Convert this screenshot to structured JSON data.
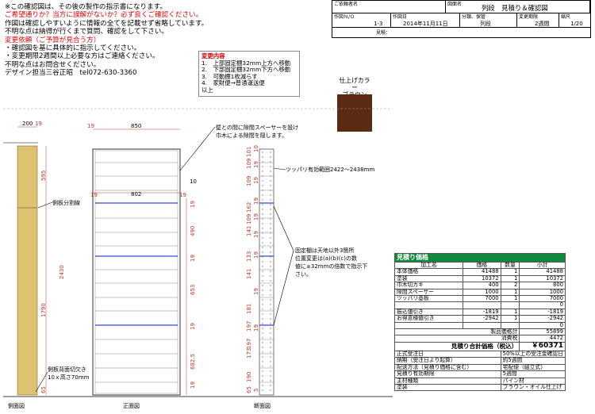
{
  "notes": {
    "lines": [
      {
        "text": "※この確認図は、その後の製作の指示書になります。",
        "mark": "※",
        "red": false
      },
      {
        "text": "ご希望通りか？当方に誤解がないか？必ず良くご確認ください。",
        "red": true
      },
      {
        "text": "作図は確認しやすいように情報の全てを記載せず省略しています。",
        "red": false
      },
      {
        "text": "不明な点は納得が行くまで質問、確認をして下さい。",
        "red": false
      },
      {
        "text": "変更依頼（ご予算が見合う方）",
        "red": true
      },
      {
        "text": "・確認図を基に具体的に指示してください。",
        "red": false
      },
      {
        "text": "・変更期限2週間以上必要な方はご連絡ください。",
        "red": false
      },
      {
        "text": "不明な点はお問合せください。",
        "red": false
      },
      {
        "text": "デザイン担当三谷正昭　tel072-630-3360",
        "red": false
      }
    ]
  },
  "header": {
    "customer_label": "ご依頼者名",
    "drawing_name_label": "図面名",
    "drawing_name": "列段　見積り＆確認図",
    "drawing_no_label": "作図Ｎ/Ｏ",
    "drawing_no": "1-3",
    "date_label": "作図日",
    "date": "2014年11月11日",
    "category_label": "分類、保管",
    "category": "列段",
    "period_label": "変更期限",
    "period": "2週間",
    "scale_label": "縮尺",
    "scale": "1/20",
    "estimate_label": "見積："
  },
  "changes": {
    "title": "変更内容",
    "items": [
      "1.　上部固定棚32mm上方へ移動",
      "2.　下部固定棚32mm下方へ移動",
      "3.　可動棚1枚減らす",
      "4.　家財便→普通運送便",
      "以上"
    ]
  },
  "finish": {
    "label": "仕上げカラー",
    "color_name": "ブラウン",
    "swatch_color": "#5b2a14"
  },
  "drawing": {
    "side_view_label": "側面図",
    "front_view_label": "正面図",
    "section_view_label": "断面図",
    "divider_label": "側板分割線",
    "cutout_label_1": "側板背面切欠き",
    "cutout_label_2": "10ｘ高さ70mm",
    "spacer_note_1": "壁との間に隙間スペーサーを設け",
    "spacer_note_2": "巾木による隙間を隠します。",
    "tension_note": "ツッパリ有効範囲2422～2438mm",
    "fixed_note_1": "固定棚は天地以外3箇所",
    "fixed_note_2": "位置変更は(a)(b)(c)の数",
    "fixed_note_3": "値に±32mmの倍数で指示下",
    "fixed_note_4": "さい。",
    "dim_side_200": "200",
    "dim_side_19": "19",
    "dim_front_19": "19",
    "dim_front_850": "850",
    "dim_inner_19a": "19",
    "dim_inner_802": "802",
    "dim_inner_19b": "19",
    "dim_inner_10": "10",
    "dim_595": "595",
    "dim_2430": "2430",
    "dim_1790": "1790",
    "dim_490": "490",
    "dim_653": "653",
    "dim_682": "682.5",
    "dim_19s": [
      "19",
      "19",
      "19",
      "19"
    ],
    "dim_65": "65",
    "section_dims": [
      "101",
      "109",
      "109",
      "162",
      "109",
      "141",
      "133",
      "141",
      "181",
      "197",
      "197",
      "173",
      "190",
      "65"
    ],
    "section_sub": [
      "10",
      "19",
      "19",
      "19",
      "19",
      "19",
      "19",
      "19",
      "19",
      "5"
    ]
  },
  "estimate": {
    "title": "見積り価格",
    "headers": [
      "加工名",
      "価格",
      "数量",
      "小計"
    ],
    "rows": [
      [
        "本体価格",
        "41488",
        "1",
        "41488"
      ],
      [
        "塗装",
        "10372",
        "1",
        "10372"
      ],
      [
        "巾木切カキ",
        "400",
        "2",
        "800"
      ],
      [
        "隙間スペーサー",
        "1000",
        "1",
        "1000"
      ],
      [
        "ツッパリ基板",
        "7000",
        "1",
        "7000"
      ],
      [
        "",
        "",
        "",
        "0"
      ],
      [
        "振込値引き",
        "-1819",
        "1",
        "-1819"
      ],
      [
        "お得意様値引き",
        "-2942",
        "1",
        "-2942"
      ],
      [
        "",
        "",
        "",
        "0"
      ]
    ],
    "product_total_label": "製品価格計",
    "product_total": "55899",
    "tax_label": "消費税",
    "tax": "4472",
    "grand_total_label": "見積り合計価格（税込）",
    "grand_total": "￥60371",
    "info": [
      [
        "正式受注日",
        "50%以上の受注金確認日"
      ],
      [
        "納期（受注日より起算）",
        "約5週間"
      ],
      [
        "配送方法（見積り価格に含む）",
        "宅配便（組立式）"
      ],
      [
        "見積り有効期限",
        "5週間"
      ],
      [
        "主材種類",
        "パイン材"
      ],
      [
        "塗装",
        "ブラウン・オイル仕上げ"
      ]
    ]
  }
}
